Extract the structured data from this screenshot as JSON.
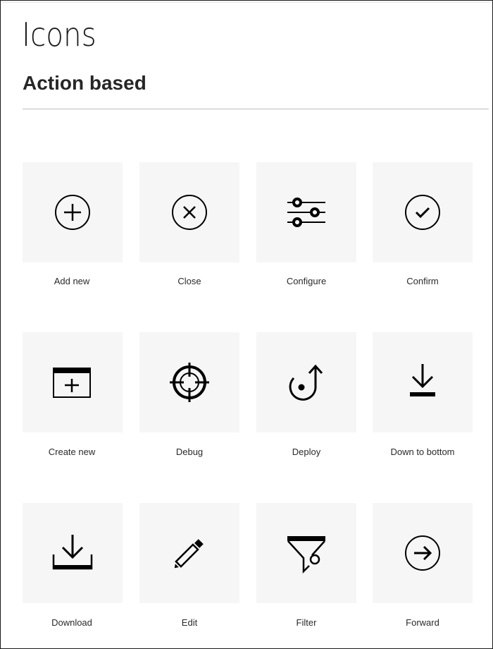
{
  "page": {
    "title": "Icons",
    "section_title": "Action based"
  },
  "icons": [
    {
      "label": "Add new",
      "icon": "add-circle-icon"
    },
    {
      "label": "Close",
      "icon": "close-circle-icon"
    },
    {
      "label": "Configure",
      "icon": "sliders-icon"
    },
    {
      "label": "Confirm",
      "icon": "checkmark-circle-icon"
    },
    {
      "label": "Create new",
      "icon": "new-window-icon"
    },
    {
      "label": "Debug",
      "icon": "crosshair-icon"
    },
    {
      "label": "Deploy",
      "icon": "deploy-arrow-icon"
    },
    {
      "label": "Down to bottom",
      "icon": "down-to-bottom-icon"
    },
    {
      "label": "Download",
      "icon": "download-icon"
    },
    {
      "label": "Edit",
      "icon": "pencil-icon"
    },
    {
      "label": "Filter",
      "icon": "funnel-icon"
    },
    {
      "label": "Forward",
      "icon": "arrow-right-circle-icon"
    }
  ],
  "colors": {
    "tile_background": "#f6f6f6",
    "icon": "#000000",
    "text": "#161616"
  }
}
